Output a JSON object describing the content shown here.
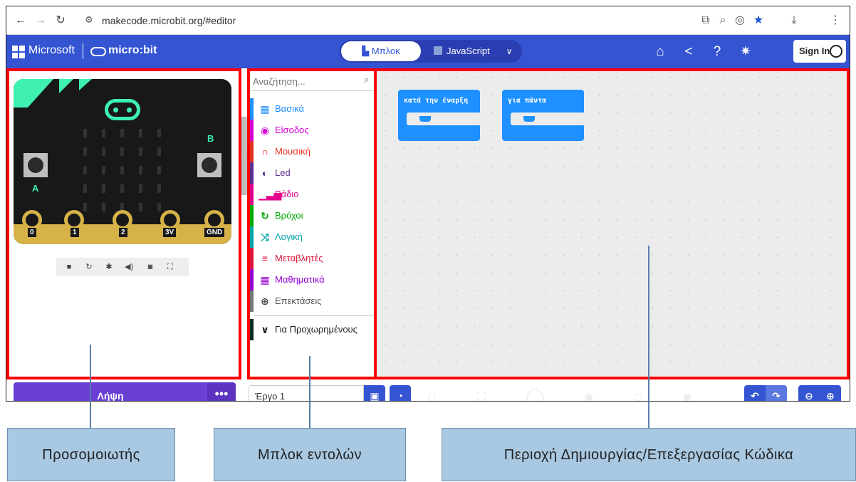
{
  "browser": {
    "url": "makecode.microbit.org/#editor"
  },
  "header": {
    "microsoft_label": "Microsoft",
    "microbit_label": "micro:bit",
    "tab_blocks": "Μπλοκ",
    "tab_javascript": "JavaScript",
    "sign_in": "Sign In"
  },
  "simulator": {
    "button_a": "A",
    "button_b": "B",
    "pins": [
      "0",
      "1",
      "2",
      "3V",
      "GND"
    ]
  },
  "toolbox": {
    "search_placeholder": "Αναζήτηση...",
    "categories": [
      {
        "label": "Βασικά",
        "color": "#1e90ff",
        "icon": "grid-icon"
      },
      {
        "label": "Είσοδος",
        "color": "#d400d4",
        "icon": "input-target-icon"
      },
      {
        "label": "Μουσική",
        "color": "#e63022",
        "icon": "headphones-icon"
      },
      {
        "label": "Led",
        "color": "#5c2d91",
        "icon": "toggle-icon"
      },
      {
        "label": "Ράδιο",
        "color": "#e3008c",
        "icon": "signal-bars-icon"
      },
      {
        "label": "Βρόχοι",
        "color": "#00a4a6",
        "icon": "loop-arrow-icon"
      },
      {
        "label": "Λογική",
        "color": "#00a4a6",
        "icon": "shuffle-icon"
      },
      {
        "label": "Μεταβλητές",
        "color": "#dc143c",
        "icon": "lines-icon"
      },
      {
        "label": "Μαθηματικά",
        "color": "#9400d3",
        "icon": "calculator-icon"
      },
      {
        "label": "Επεκτάσεις",
        "color": "#757575",
        "icon": "plus-circle-icon"
      },
      {
        "label": "Για Προχωρημένους",
        "color": "#000000",
        "icon": "chevron-down-icon"
      }
    ]
  },
  "workspace": {
    "on_start": "κατά την έναρξη",
    "forever": "για πάντα"
  },
  "bottom": {
    "download": "Λήψη",
    "more": "•••",
    "project_name": "Έργο 1"
  },
  "annotations": {
    "simulator": "Προσομοιωτής",
    "blocks": "Μπλοκ εντολών",
    "editor": "Περιοχή Δημιουργίας/Επεξεργασίας Κώδικα"
  }
}
